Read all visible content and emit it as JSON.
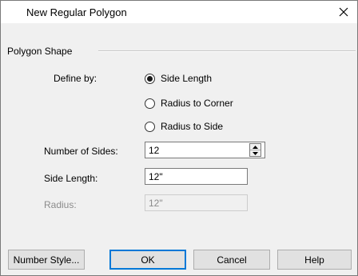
{
  "window": {
    "title": "New Regular Polygon"
  },
  "group": {
    "label": "Polygon Shape"
  },
  "define_by": {
    "label": "Define by:",
    "options": [
      "Side Length",
      "Radius to Corner",
      "Radius to Side"
    ],
    "selected": "Side Length"
  },
  "number_of_sides": {
    "label": "Number of Sides:",
    "value": "12"
  },
  "side_length": {
    "label": "Side Length:",
    "value": "12\""
  },
  "radius": {
    "label": "Radius:",
    "value": "12\""
  },
  "buttons": {
    "number_style": "Number Style...",
    "ok": "OK",
    "cancel": "Cancel",
    "help": "Help"
  },
  "icons": {
    "close": "close-icon",
    "spin_up": "spin-up-icon",
    "spin_down": "spin-down-icon"
  },
  "colors": {
    "dialog_bg": "#f0f0f0",
    "title_bg": "#ffffff",
    "default_button_border": "#0078d7",
    "disabled_text": "#8b8b8b"
  }
}
